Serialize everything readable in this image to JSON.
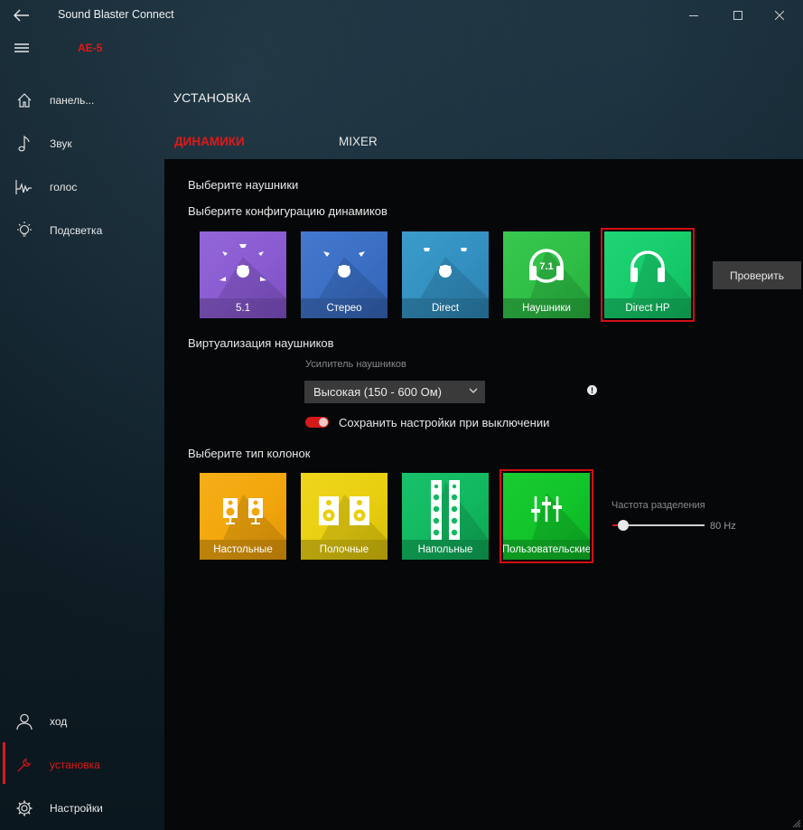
{
  "app": {
    "title": "Sound Blaster Connect",
    "device": "AE-5",
    "accent_color": "#e01818"
  },
  "sidebar": {
    "items": [
      {
        "label": "панель...",
        "icon": "home-icon"
      },
      {
        "label": "Звук",
        "icon": "music-note-icon"
      },
      {
        "label": "голос",
        "icon": "voice-wave-icon"
      },
      {
        "label": "Подсветка",
        "icon": "lightbulb-icon"
      }
    ],
    "bottom_items": [
      {
        "label": "ход",
        "icon": "user-icon"
      },
      {
        "label": "установка",
        "icon": "wrench-icon",
        "active": true
      },
      {
        "label": "Настройки",
        "icon": "gear-icon"
      }
    ]
  },
  "header": {
    "section_title": "УСТАНОВКА",
    "tabs": [
      {
        "label": "ДИНАМИКИ",
        "active": true
      },
      {
        "label": "MIXER",
        "active": false
      }
    ]
  },
  "main": {
    "choose_headphones": "Выберите наушники",
    "choose_speaker_config": "Выберите конфигурацию динамиков",
    "speaker_configs": [
      {
        "label": "5.1",
        "color": "#8a5bd1",
        "icon": "surround-5-1-icon"
      },
      {
        "label": "Стерео",
        "color": "#3b6fc4",
        "icon": "stereo-icon"
      },
      {
        "label": "Direct",
        "color": "#3390c0",
        "icon": "direct-icon"
      },
      {
        "label": "Наушники",
        "color": "#2fbf46",
        "icon": "headphones-7-1-icon"
      },
      {
        "label": "Direct HP",
        "color": "#16cc6a",
        "icon": "headphones-icon",
        "selected": true
      }
    ],
    "test_button": "Проверить",
    "virtualization_title": "Виртуализация наушников",
    "amp_label": "Усилитель наушников",
    "amp_value": "Высокая (150 - 600 Ом)",
    "save_settings_label": "Сохранить настройки при выключении",
    "save_settings_on": true,
    "choose_speaker_type": "Выберите тип колонок",
    "speaker_types": [
      {
        "label": "Настольные",
        "color": "#f2a60c",
        "icon": "desktop-speakers-icon"
      },
      {
        "label": "Полочные",
        "color": "#e8cf10",
        "icon": "bookshelf-speakers-icon"
      },
      {
        "label": "Напольные",
        "color": "#12b860",
        "icon": "floor-speakers-icon"
      },
      {
        "label": "Пользовательские",
        "color": "#11c42a",
        "icon": "equalizer-sliders-icon",
        "selected": true
      }
    ],
    "crossover_label": "Частота разделения",
    "crossover_value": "80 Hz",
    "crossover_level": 0.1
  }
}
